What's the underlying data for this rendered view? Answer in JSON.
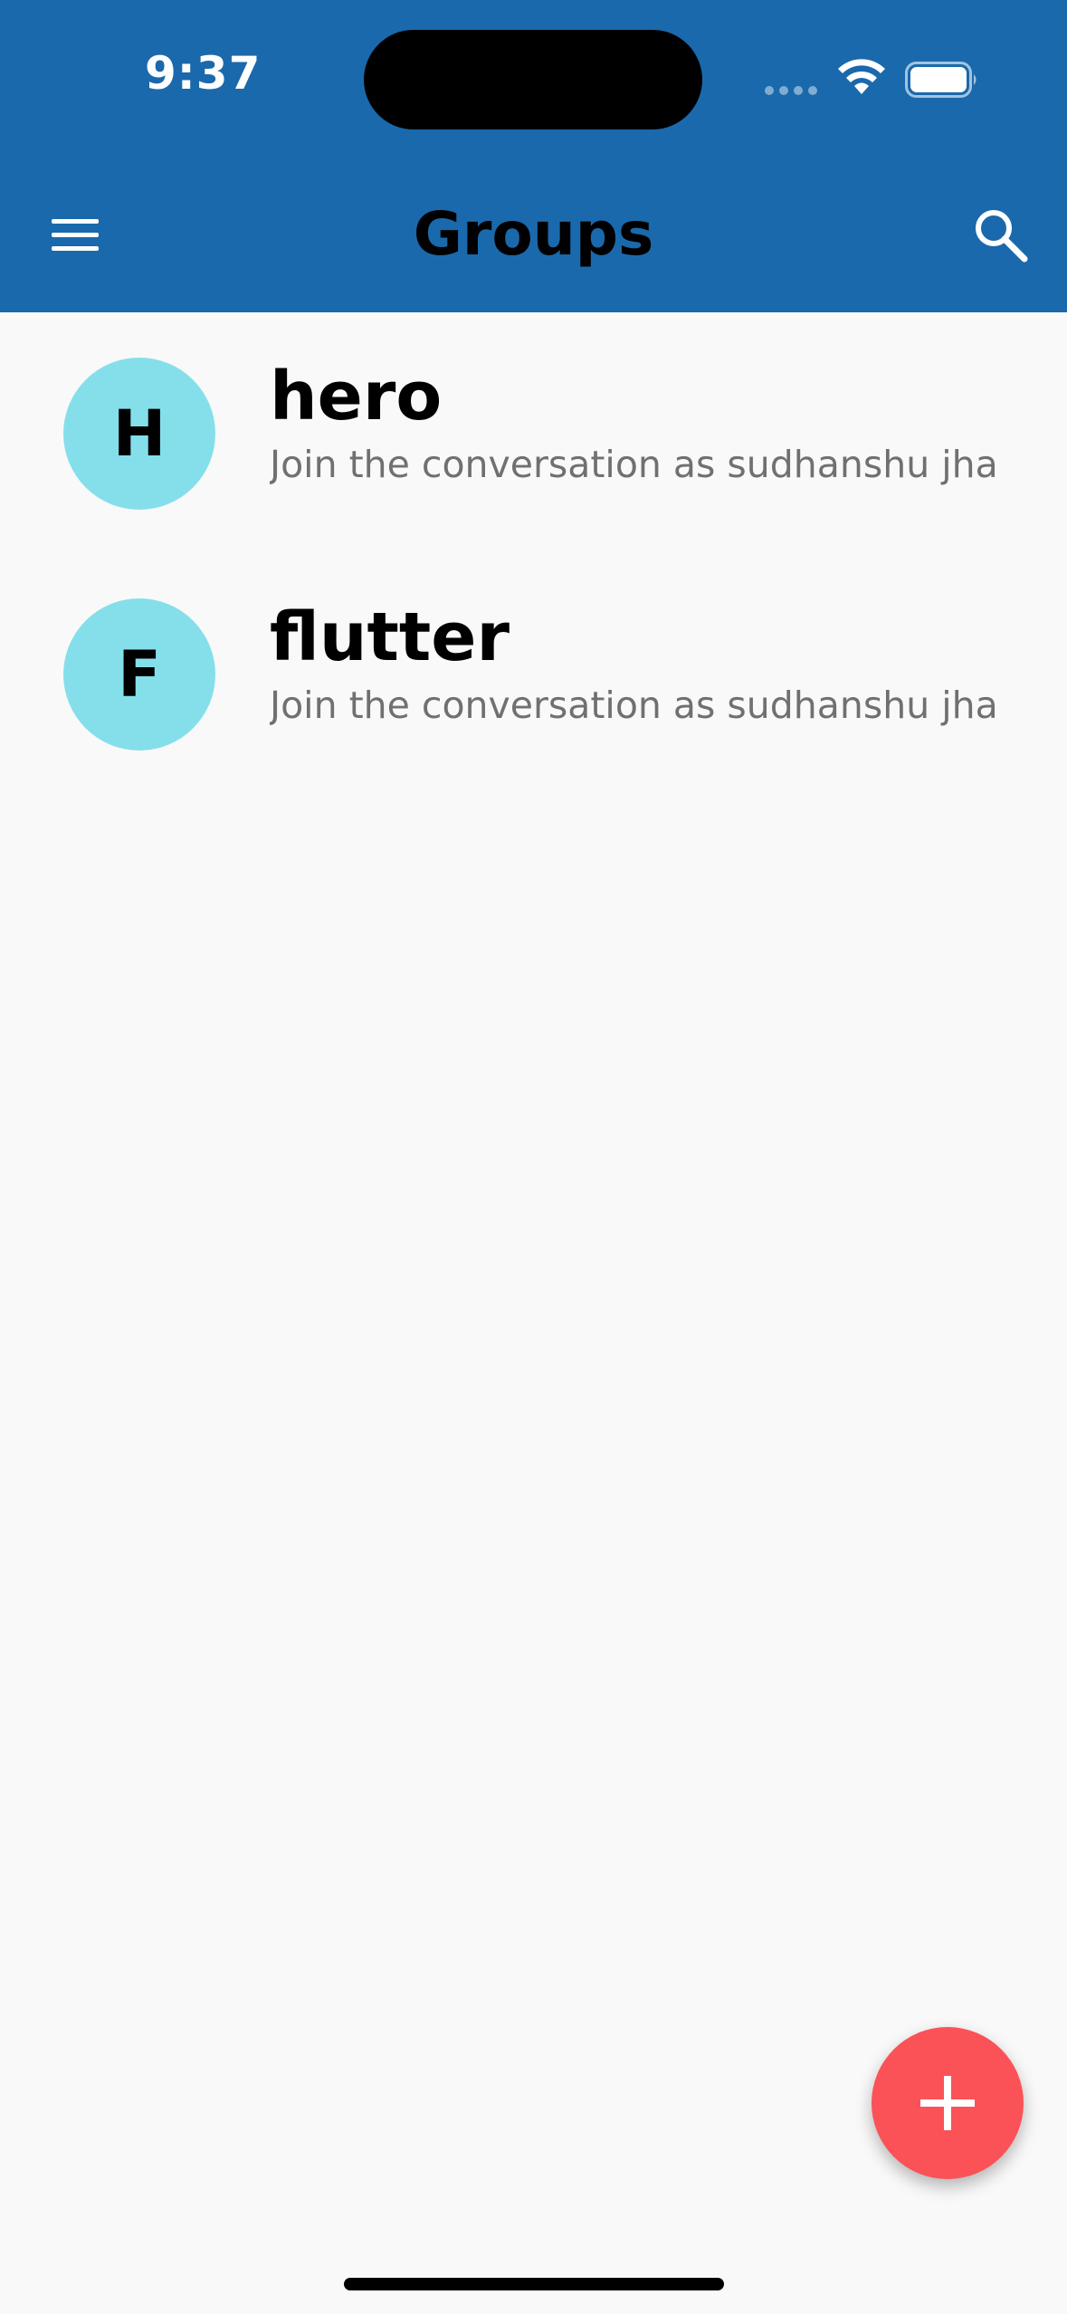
{
  "status_bar": {
    "time": "9:37"
  },
  "app_bar": {
    "title": "Groups",
    "menu_icon": "hamburger-menu-icon",
    "search_icon": "search-icon",
    "background_color": "#1a69ac"
  },
  "groups": [
    {
      "initial": "H",
      "name": "hero",
      "subtitle": "Join the conversation as sudhanshu jha"
    },
    {
      "initial": "F",
      "name": "flutter",
      "subtitle": "Join the conversation as sudhanshu jha"
    }
  ],
  "fab": {
    "icon": "plus-icon",
    "color": "#fa5257"
  },
  "colors": {
    "avatar": "#84dfeb",
    "subtitle_text": "#707070",
    "background": "#f9f9f9"
  }
}
